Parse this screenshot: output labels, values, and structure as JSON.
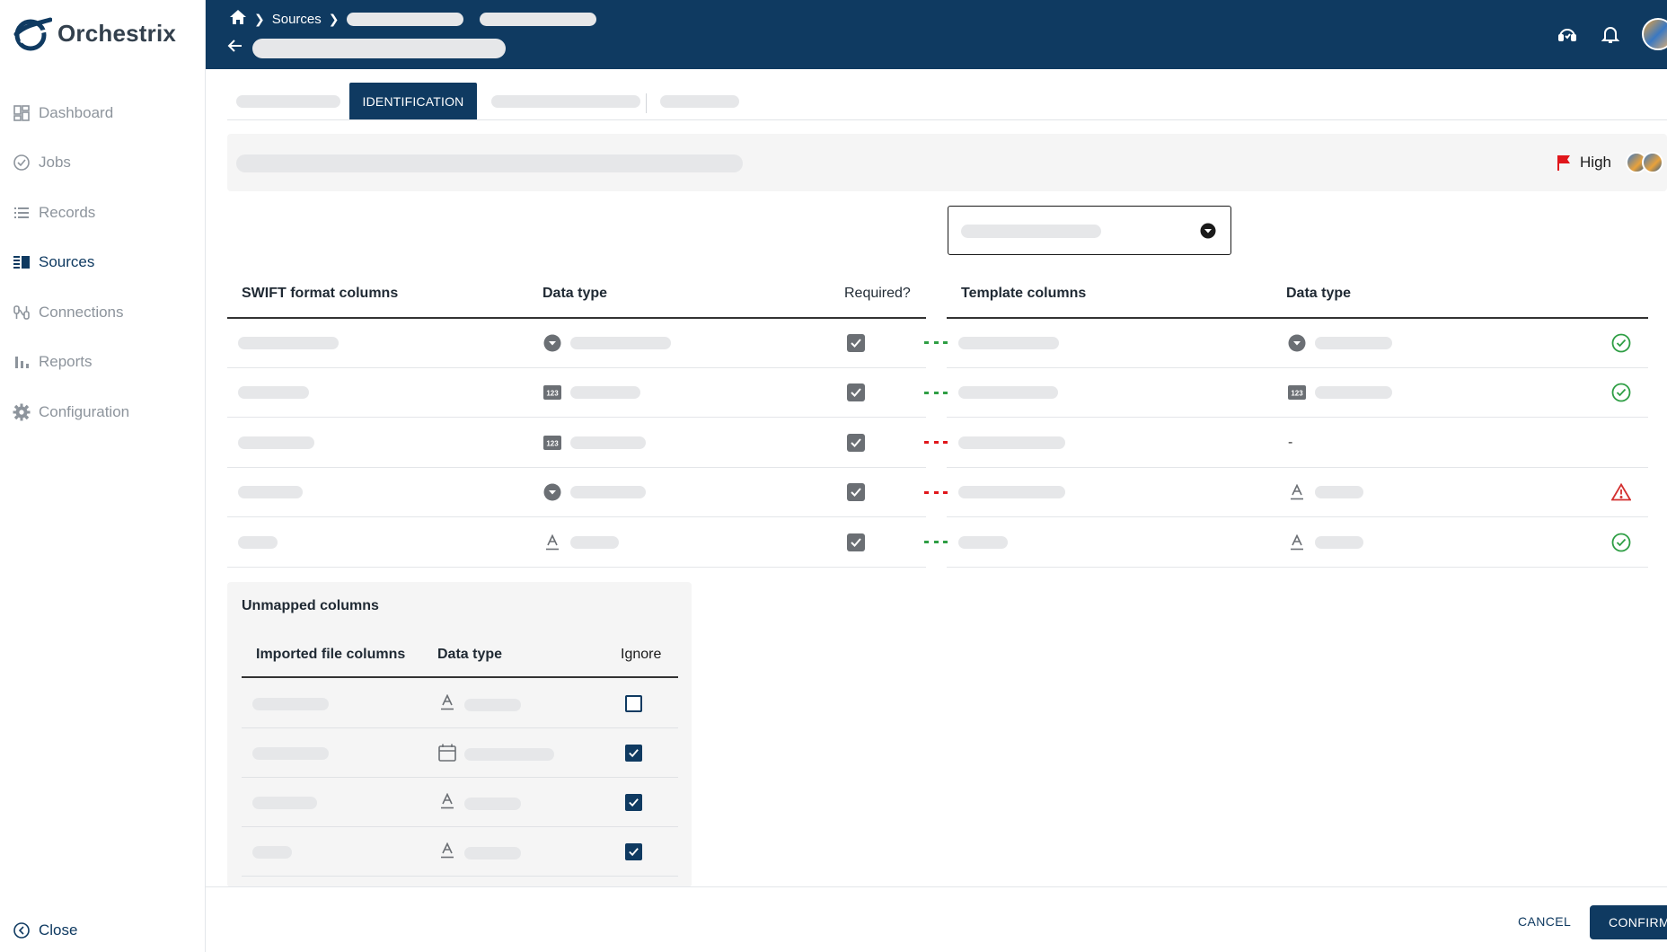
{
  "app": {
    "name": "Orchestrix"
  },
  "sidebar": {
    "items": [
      {
        "label": "Dashboard",
        "icon": "dashboard-icon"
      },
      {
        "label": "Jobs",
        "icon": "check-circle-icon"
      },
      {
        "label": "Records",
        "icon": "list-icon"
      },
      {
        "label": "Sources",
        "icon": "sources-icon",
        "active": true
      },
      {
        "label": "Connections",
        "icon": "connections-icon"
      },
      {
        "label": "Reports",
        "icon": "bar-chart-icon"
      },
      {
        "label": "Configuration",
        "icon": "gear-icon"
      }
    ],
    "close_label": "Close"
  },
  "header": {
    "breadcrumb": {
      "home_icon": "home-icon",
      "item1": "Sources"
    },
    "icons": [
      "support-icon",
      "bell-icon",
      "avatar"
    ]
  },
  "tabs": {
    "active_label": "IDENTIFICATION"
  },
  "task": {
    "priority": "High",
    "priority_color": "#e0161b"
  },
  "mapping": {
    "headers": {
      "source_col": "SWIFT format columns",
      "source_type": "Data type",
      "required": "Required?",
      "template_col": "Template columns",
      "template_type": "Data type"
    },
    "rows": [
      {
        "src_type_icon": "dropdown-type-icon",
        "link": "matched",
        "tpl_type_icon": "dropdown-type-icon",
        "tpl_type_text": "",
        "status": "ok"
      },
      {
        "src_type_icon": "number-type-icon",
        "link": "matched",
        "tpl_type_icon": "number-type-icon",
        "tpl_type_text": "",
        "status": "ok"
      },
      {
        "src_type_icon": "number-type-icon",
        "link": "unmatched",
        "tpl_type_icon": "",
        "tpl_type_text": "-",
        "status": "none"
      },
      {
        "src_type_icon": "dropdown-type-icon",
        "link": "unmatched",
        "tpl_type_icon": "text-type-icon",
        "tpl_type_text": "",
        "status": "warning"
      },
      {
        "src_type_icon": "text-type-icon",
        "link": "matched",
        "tpl_type_icon": "text-type-icon",
        "tpl_type_text": "",
        "status": "ok"
      }
    ],
    "colors": {
      "matched": "#2e9e44",
      "unmatched": "#e0161b",
      "warning": "#d32f2f"
    }
  },
  "unmapped": {
    "title": "Unmapped columns",
    "headers": {
      "col": "Imported file columns",
      "type": "Data type",
      "ignore": "Ignore"
    },
    "rows": [
      {
        "type_icon": "text-type-icon",
        "ignored": false
      },
      {
        "type_icon": "calendar-icon",
        "ignored": true
      },
      {
        "type_icon": "text-type-icon",
        "ignored": true
      },
      {
        "type_icon": "text-type-icon",
        "ignored": true
      }
    ]
  },
  "footer": {
    "cancel_label": "CANCEL",
    "confirm_label": "CONFIRM"
  },
  "colors": {
    "primary": "#0f3a61",
    "skeleton": "#e6e7e9"
  }
}
